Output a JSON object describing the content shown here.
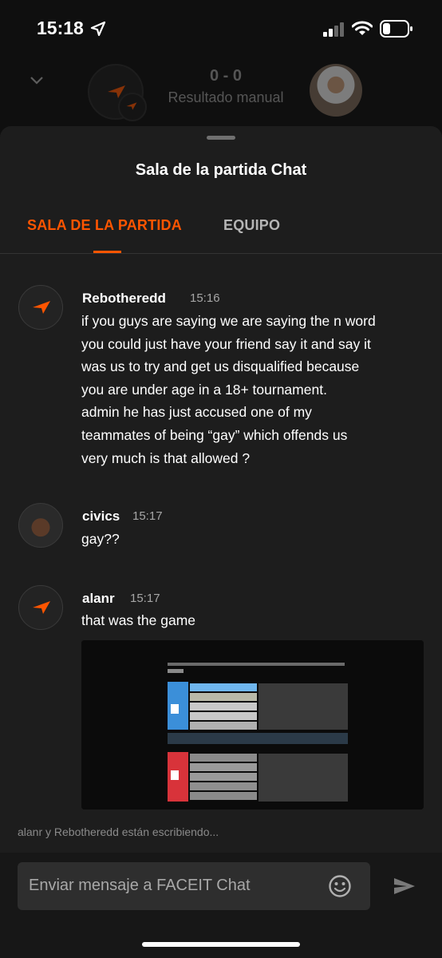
{
  "status_bar": {
    "time": "15:18"
  },
  "match": {
    "score": "0 - 0",
    "mode": "Resultado manual"
  },
  "sheet": {
    "title": "Sala de la partida Chat",
    "tabs": [
      {
        "label": "SALA DE LA PARTIDA",
        "active": true
      },
      {
        "label": "EQUIPO",
        "active": false
      }
    ]
  },
  "messages": [
    {
      "author": "Rebotheredd",
      "time": "15:16",
      "avatar": "faceit-logo",
      "lines": [
        "if you guys are saying we are saying the n word",
        "you could just have your friend say it and say it",
        "was us to try and get us disqualified because",
        "you are under age in a 18+ tournament.",
        "admin he has just accused one of my",
        "teammates of being “gay” which offends us",
        "very much is that allowed ?"
      ]
    },
    {
      "author": "civics",
      "time": "15:17",
      "avatar": "user-photo",
      "lines": [
        "gay??"
      ]
    },
    {
      "author": "alanr",
      "time": "15:17",
      "avatar": "faceit-logo",
      "lines": [
        "that was the game"
      ],
      "attachment": "scoreboard-screenshot"
    }
  ],
  "typing_indicator": "alanr y Rebotheredd están escribiendo...",
  "composer": {
    "placeholder": "Enviar mensaje a FACEIT Chat"
  },
  "colors": {
    "accent": "#ff5500",
    "sheet": "#1d1d1d",
    "input": "#2e2e2e"
  }
}
